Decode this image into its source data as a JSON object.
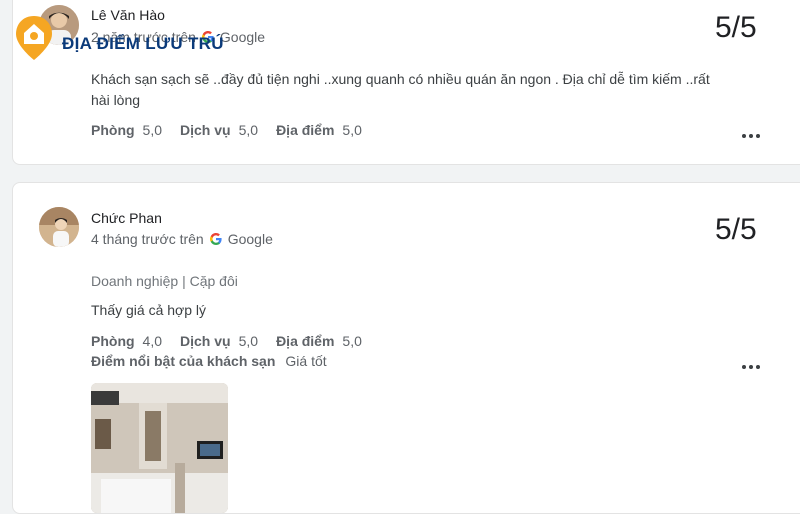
{
  "watermark": {
    "text": "ĐỊA ĐIỂM LƯU TRÚ"
  },
  "reviews": [
    {
      "name": "Lê Văn Hào",
      "time": "2 năm trước trên",
      "source": "Google",
      "score": "5/5",
      "text": "Khách sạn sạch sẽ ..đầy đủ tiện nghi ..xung quanh có nhiều quán ăn ngon . Địa chỉ dễ tìm kiếm ..rất hài lòng",
      "ratings": [
        {
          "label": "Phòng",
          "value": "5,0"
        },
        {
          "label": "Dịch vụ",
          "value": "5,0"
        },
        {
          "label": "Địa điểm",
          "value": "5,0"
        }
      ]
    },
    {
      "name": "Chức Phan",
      "time": "4 tháng trước trên",
      "source": "Google",
      "score": "5/5",
      "trip_type": "Doanh nghiệp | Cặp đôi",
      "text": "Thấy giá cả hợp lý",
      "ratings": [
        {
          "label": "Phòng",
          "value": "4,0"
        },
        {
          "label": "Dịch vụ",
          "value": "5,0"
        },
        {
          "label": "Địa điểm",
          "value": "5,0"
        }
      ],
      "highlight": {
        "label": "Điểm nổi bật của khách sạn",
        "value": "Giá tốt"
      }
    }
  ],
  "icons": {
    "google": "google-g-icon",
    "more": "more-options-icon"
  }
}
